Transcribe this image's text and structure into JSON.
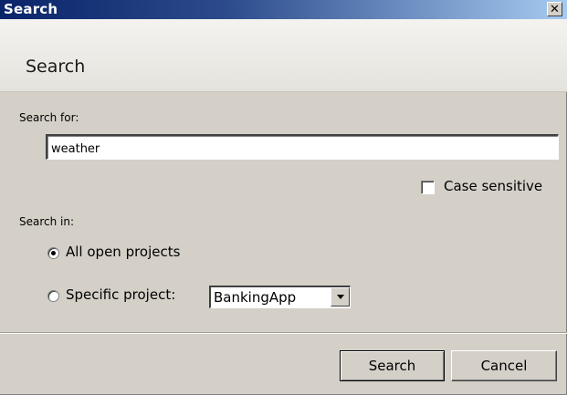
{
  "window": {
    "title": "Search",
    "close_glyph": "✕"
  },
  "header": {
    "title": "Search"
  },
  "search_for": {
    "label": "Search for:",
    "value": "weather"
  },
  "case_sensitive": {
    "label": "Case sensitive",
    "checked": false
  },
  "search_in": {
    "label": "Search in:",
    "options": [
      {
        "label": "All open projects",
        "selected": true
      },
      {
        "label": "Specific project:",
        "selected": false
      }
    ],
    "project_select": {
      "value": "BankingApp"
    }
  },
  "buttons": {
    "search": "Search",
    "cancel": "Cancel"
  }
}
